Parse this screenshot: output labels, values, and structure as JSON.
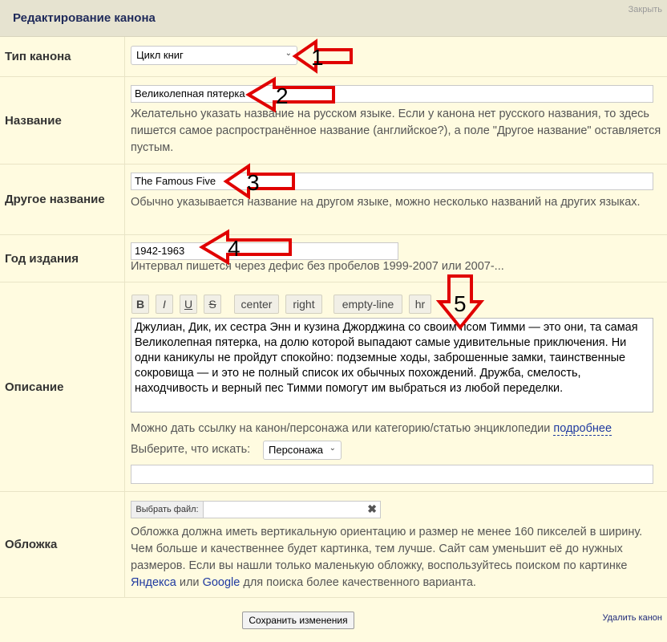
{
  "header": {
    "title": "Редактирование канона",
    "close_label": "Закрыть"
  },
  "canon_type": {
    "label": "Тип канона",
    "value": "Цикл книг"
  },
  "name": {
    "label": "Название",
    "value": "Великолепная пятерка",
    "hint": "Желательно указать название на русском языке. Если у канона нет русского названия, то здесь пишется самое распространённое название (английское?), а поле \"Другое название\" оставляется пустым."
  },
  "other_name": {
    "label": "Другое название",
    "value": "The Famous Five",
    "hint": "Обычно указывается название на другом языке, можно несколько названий на других языках."
  },
  "year": {
    "label": "Год издания",
    "value": "1942-1963",
    "hint": "Интервал пишется через дефис без пробелов 1999-2007 или 2007-..."
  },
  "description": {
    "label": "Описание",
    "toolbar": {
      "bold": "B",
      "italic": "I",
      "underline": "U",
      "strike": "S",
      "center": "center",
      "right": "right",
      "empty_line": "empty-line",
      "hr": "hr"
    },
    "text": "Джулиан, Дик, их сестра Энн и кузина Джорджина со своим псом Тимми — это они, та самая Великолепная пятерка, на долю которой выпадают самые удивительные приключения. Ни одни каникулы не пройдут спокойно: подземные ходы, заброшенные замки, таинственные сокровища — и это не полный список их обычных похождений. Дружба, смелость, находчивость и верный пес Тимми помогут им выбраться из любой переделки.",
    "link_hint": "Можно дать ссылку на канон/персонажа или категорию/статью энциклопедии",
    "link_more": "подробнее",
    "search_label": "Выберите, что искать:",
    "search_type": "Персонажа",
    "search_value": ""
  },
  "cover": {
    "label": "Обложка",
    "file_button": "Выбрать файл:",
    "clear_icon": "✖",
    "hint_part1": "Обложка должна иметь вертикальную ориентацию и размер не менее 160 пикселей в ширину. Чем больше и качественнее будет картинка, тем лучше. Сайт сам уменьшит её до нужных размеров. Если вы нашли только маленькую обложку, воспользуйтесь поиском по картинке",
    "yandex": "Яндекса",
    "or": "или",
    "google": "Google",
    "hint_part2": "для поиска более качественного варианта."
  },
  "footer": {
    "save_label": "Сохранить изменения",
    "delete_label": "Удалить канон"
  },
  "annotations": {
    "a1": "1",
    "a2": "2",
    "a3": "3",
    "a4": "4",
    "a5": "5"
  },
  "colors": {
    "arrow": "#e00000",
    "background": "#fffbe0",
    "header": "#e6e3d0"
  }
}
